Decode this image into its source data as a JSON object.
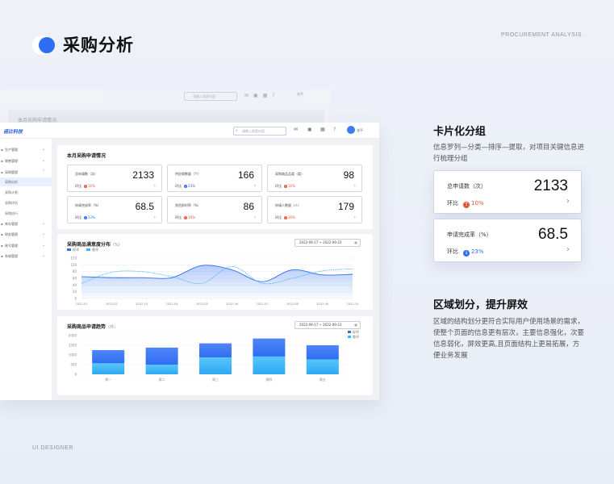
{
  "header": {
    "title": "采购分析",
    "subtitle_en": "PROCUREMENT ANALYSIS",
    "footer": "UI DESIGNER"
  },
  "ghost": {
    "search_placeholder": "请输入搜索内容",
    "user": "张平",
    "panel_title": "本月采购申请情况"
  },
  "app": {
    "brand": "诺比科技",
    "search_placeholder": "请输入搜索内容",
    "user": "张平",
    "sidebar": [
      {
        "label": "生产管理",
        "chevron": "⌄"
      },
      {
        "label": "销售管理",
        "chevron": "⌄"
      },
      {
        "label": "采购管理",
        "chevron": "⌃"
      },
      {
        "label": "采购分析",
        "chevron": ""
      },
      {
        "label": "采购计划",
        "chevron": ""
      },
      {
        "label": "采购评估",
        "chevron": ""
      },
      {
        "label": "采购执行",
        "chevron": ""
      },
      {
        "label": "库存管理",
        "chevron": "⌄"
      },
      {
        "label": "财务管理",
        "chevron": "⌄"
      },
      {
        "label": "账号管理",
        "chevron": "⌄"
      },
      {
        "label": "系统管理",
        "chevron": "⌄"
      }
    ],
    "overview": {
      "title": "本月采购申请情况",
      "compare_label": "环比",
      "cards": [
        {
          "label": "总申请数（次）",
          "value": "2133",
          "pct": "10%",
          "dir": "up"
        },
        {
          "label": "供应商数量（个）",
          "value": "166",
          "pct": "23%",
          "dir": "down"
        },
        {
          "label": "采购商品品类（类）",
          "value": "98",
          "pct": "10%",
          "dir": "up"
        },
        {
          "label": "申请完成率（%）",
          "value": "68.5",
          "pct": "23%",
          "dir": "down"
        },
        {
          "label": "到货即时率（%）",
          "value": "86",
          "pct": "10%",
          "dir": "up"
        },
        {
          "label": "申请人数量（人）",
          "value": "179",
          "pct": "30%",
          "dir": "up"
        }
      ]
    },
    "satisfaction": {
      "title": "采购商品满意度分布",
      "unit": "（%）",
      "date_range": "2022-09-17 ~ 2022-09-23"
    },
    "trend": {
      "title": "采购商品申请趋势",
      "unit": "（件）",
      "date_range": "2022-09-17 ~ 2022-09-23"
    }
  },
  "chart_data": [
    {
      "type": "line",
      "title": "采购商品满意度分布",
      "x": [
        "2022-01",
        "2022-02",
        "2022-03",
        "2022-04",
        "2022-05",
        "2022-06",
        "2022-07",
        "2022-08",
        "2022-09",
        "2022-10"
      ],
      "ylim": [
        0,
        120
      ],
      "yticks": [
        0,
        20,
        40,
        60,
        80,
        100,
        120
      ],
      "legend": [
        "好评",
        "差评"
      ],
      "series": [
        {
          "name": "好评",
          "values": [
            65,
            62,
            62,
            62,
            98,
            85,
            50,
            85,
            70,
            72
          ],
          "color": "#2f6df2"
        },
        {
          "name": "差评",
          "values": [
            45,
            78,
            80,
            65,
            45,
            95,
            45,
            60,
            82,
            88
          ],
          "color": "#38b6f5"
        }
      ]
    },
    {
      "type": "bar",
      "title": "采购商品申请趋势",
      "categories": [
        "周一",
        "周二",
        "周三",
        "周四",
        "周五"
      ],
      "ylim": [
        0,
        2000
      ],
      "yticks": [
        0,
        500,
        1000,
        1500,
        2000
      ],
      "legend": [
        "好评",
        "差评"
      ],
      "series": [
        {
          "name": "好评",
          "values": [
            680,
            880,
            730,
            930,
            730
          ],
          "color": "#2f6df2"
        },
        {
          "name": "差评",
          "values": [
            570,
            500,
            870,
            920,
            770
          ],
          "color": "#38b6f5"
        }
      ]
    }
  ],
  "right": {
    "sec1": {
      "title": "卡片化分组",
      "desc": "信息罗列—分类—排序—提取，对项目关键信息进行梳理分组"
    },
    "compare_label": "环比",
    "cards": [
      {
        "label": "总申请数（次）",
        "value": "2133",
        "pct": "10%",
        "dir": "up"
      },
      {
        "label": "申请完成率（%）",
        "value": "68.5",
        "pct": "23%",
        "dir": "down"
      }
    ],
    "sec2": {
      "title": "区域划分，提升屏效",
      "desc": "区域的结构划分更符合实际用户使用场景的需求，使整个页面的信息更有层次，主要信息强化，次要信息弱化，屏效更高,且页面结构上更易拓展，方便业务发展"
    }
  },
  "colors": {
    "accent": "#2f6df2",
    "light": "#38b6f5",
    "up": "#e4553b"
  },
  "icons": [
    "search-icon",
    "message-icon",
    "app-icon",
    "calendar-icon",
    "help-icon",
    "chevron-right-icon",
    "arrow-up-icon",
    "arrow-down-icon"
  ]
}
